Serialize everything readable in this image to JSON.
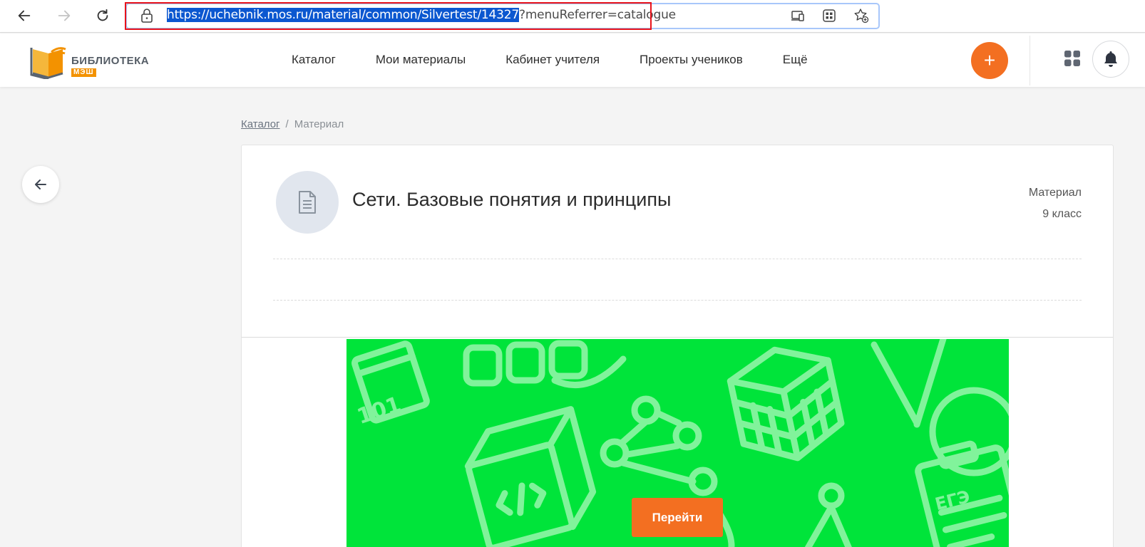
{
  "browser": {
    "url_selected": "https://uchebnik.mos.ru/material/common/Silvertest/14327",
    "url_rest": "?menuReferrer=catalogue",
    "icons": [
      "back-arrow-icon",
      "forward-arrow-icon",
      "reload-icon",
      "lock-icon",
      "device-cast-icon",
      "qr-grid-icon",
      "favorites-add-icon"
    ]
  },
  "header": {
    "logo_title": "БИБЛИОТЕКА",
    "logo_sub": "МЭШ",
    "nav": [
      "Каталог",
      "Мои материалы",
      "Кабинет учителя",
      "Проекты учеников",
      "Ещё"
    ],
    "plus_label": "+"
  },
  "breadcrumb": {
    "link": "Каталог",
    "separator": "/",
    "current": "Материал"
  },
  "material": {
    "title": "Сети. Базовые понятия и принципы",
    "type": "Материал",
    "grade": "9 класс",
    "go_button": "Перейти"
  },
  "colors": {
    "accent": "#f36f21",
    "cover_green": "#00e43a",
    "url_selection": "#0b57d0",
    "highlight_box": "#e8131b"
  }
}
